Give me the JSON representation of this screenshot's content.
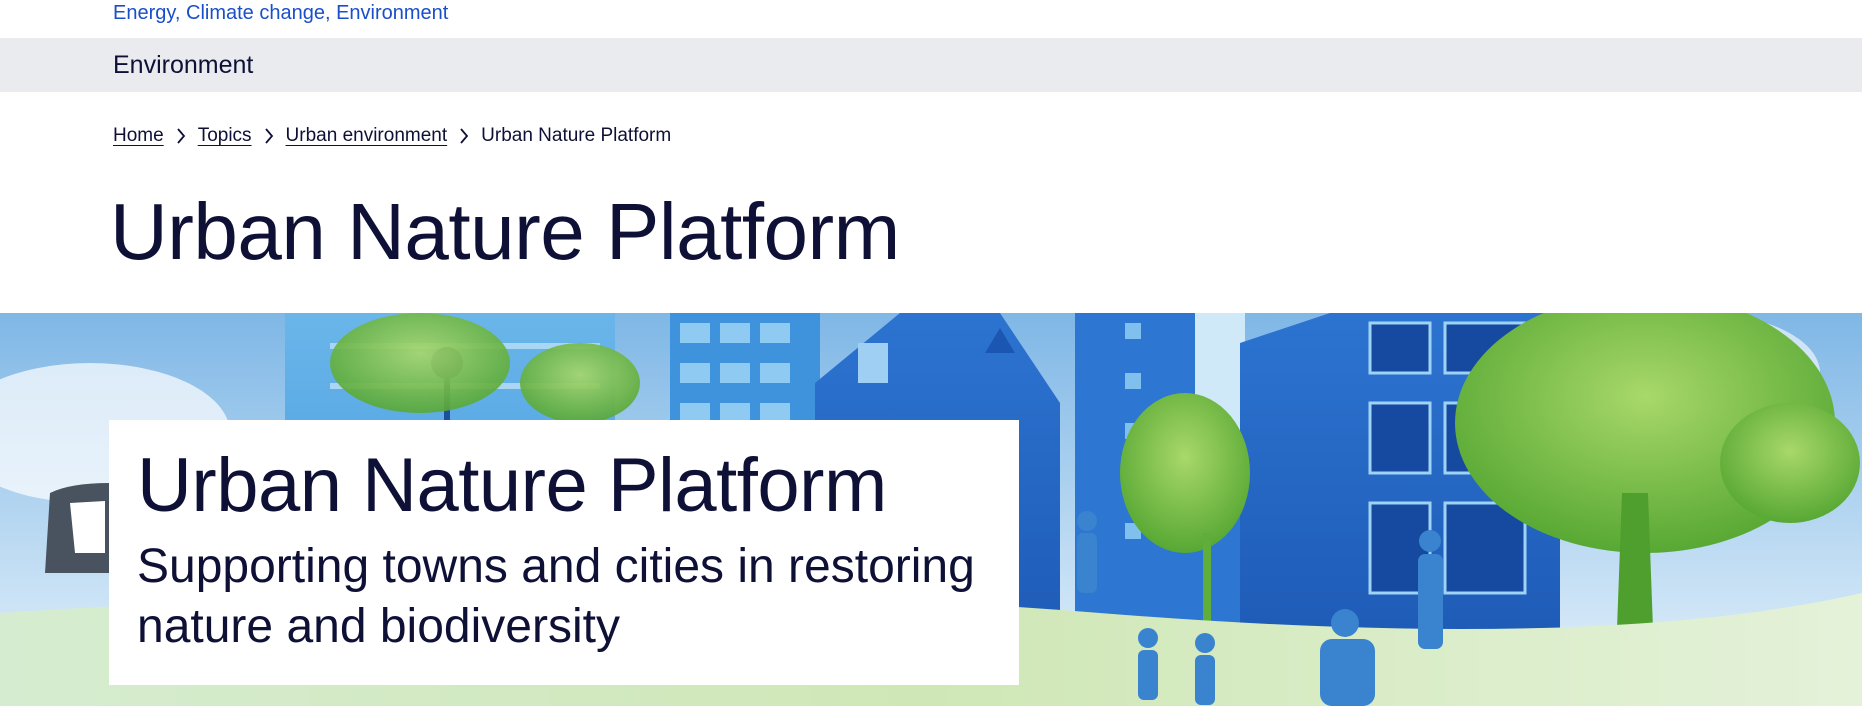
{
  "topics": {
    "text": "Energy, Climate change, Environment"
  },
  "section": {
    "title": "Environment"
  },
  "breadcrumb": {
    "items": [
      "Home",
      "Topics",
      "Urban environment"
    ],
    "current": "Urban Nature Platform"
  },
  "page": {
    "title": "Urban Nature Platform"
  },
  "hero": {
    "title": "Urban Nature Platform",
    "subtitle": "Supporting towns and cities in restoring nature and biodiversity"
  },
  "colors": {
    "link": "#1a4fc9",
    "text": "#0e1036",
    "section_bar": "#eaebee",
    "building_blue": "#1f5fbf",
    "tree_green": "#7cc241"
  }
}
